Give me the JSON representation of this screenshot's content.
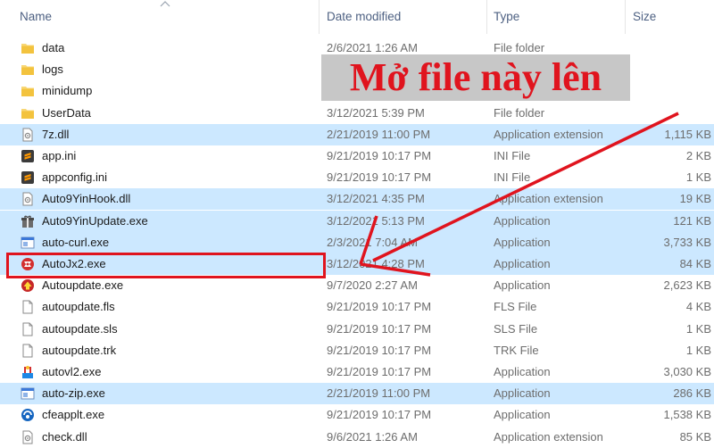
{
  "columns": {
    "name": "Name",
    "date_modified": "Date modified",
    "type": "Type",
    "size": "Size"
  },
  "annotation": {
    "label": "Mở file này lên",
    "color": "#e0141e"
  },
  "files": [
    {
      "name": "data",
      "date": "2/6/2021 1:26 AM",
      "type": "File folder",
      "size": "",
      "icon": "folder-icon",
      "selected": false
    },
    {
      "name": "logs",
      "date": "",
      "type": "",
      "size": "",
      "icon": "folder-icon",
      "selected": false
    },
    {
      "name": "minidump",
      "date": "",
      "type": "",
      "size": "",
      "icon": "folder-icon",
      "selected": false
    },
    {
      "name": "UserData",
      "date": "3/12/2021 5:39 PM",
      "type": "File folder",
      "size": "",
      "icon": "folder-icon",
      "selected": false
    },
    {
      "name": "7z.dll",
      "date": "2/21/2019 11:00 PM",
      "type": "Application extension",
      "size": "1,115 KB",
      "icon": "dll-icon",
      "selected": true
    },
    {
      "name": "app.ini",
      "date": "9/21/2019 10:17 PM",
      "type": "INI File",
      "size": "2 KB",
      "icon": "sublime-icon",
      "selected": false
    },
    {
      "name": "appconfig.ini",
      "date": "9/21/2019 10:17 PM",
      "type": "INI File",
      "size": "1 KB",
      "icon": "sublime-icon",
      "selected": false
    },
    {
      "name": "Auto9YinHook.dll",
      "date": "3/12/2021 4:35 PM",
      "type": "Application extension",
      "size": "19 KB",
      "icon": "dll-icon",
      "selected": true
    },
    {
      "name": "Auto9YinUpdate.exe",
      "date": "3/12/2021 5:13 PM",
      "type": "Application",
      "size": "121 KB",
      "icon": "gift-icon",
      "selected": true
    },
    {
      "name": "auto-curl.exe",
      "date": "2/3/2021 7:04 AM",
      "type": "Application",
      "size": "3,733 KB",
      "icon": "window-app-icon",
      "selected": true
    },
    {
      "name": "AutoJx2.exe",
      "date": "3/12/2021 4:28 PM",
      "type": "Application",
      "size": "84 KB",
      "icon": "autojx-icon",
      "selected": true
    },
    {
      "name": "Autoupdate.exe",
      "date": "9/7/2020 2:27 AM",
      "type": "Application",
      "size": "2,623 KB",
      "icon": "autoupdate-icon",
      "selected": false
    },
    {
      "name": "autoupdate.fls",
      "date": "9/21/2019 10:17 PM",
      "type": "FLS File",
      "size": "4 KB",
      "icon": "blank-file-icon",
      "selected": false
    },
    {
      "name": "autoupdate.sls",
      "date": "9/21/2019 10:17 PM",
      "type": "SLS File",
      "size": "1 KB",
      "icon": "blank-file-icon",
      "selected": false
    },
    {
      "name": "autoupdate.trk",
      "date": "9/21/2019 10:17 PM",
      "type": "TRK File",
      "size": "1 KB",
      "icon": "blank-file-icon",
      "selected": false
    },
    {
      "name": "autovl2.exe",
      "date": "9/21/2019 10:17 PM",
      "type": "Application",
      "size": "3,030 KB",
      "icon": "autovl-icon",
      "selected": false
    },
    {
      "name": "auto-zip.exe",
      "date": "2/21/2019 11:00 PM",
      "type": "Application",
      "size": "286 KB",
      "icon": "window-app-icon",
      "selected": true
    },
    {
      "name": "cfeapplt.exe",
      "date": "9/21/2019 10:17 PM",
      "type": "Application",
      "size": "1,538 KB",
      "icon": "cfe-icon",
      "selected": false
    },
    {
      "name": "check.dll",
      "date": "9/6/2021 1:26 AM",
      "type": "Application extension",
      "size": "85 KB",
      "icon": "dll-icon",
      "selected": false
    }
  ]
}
